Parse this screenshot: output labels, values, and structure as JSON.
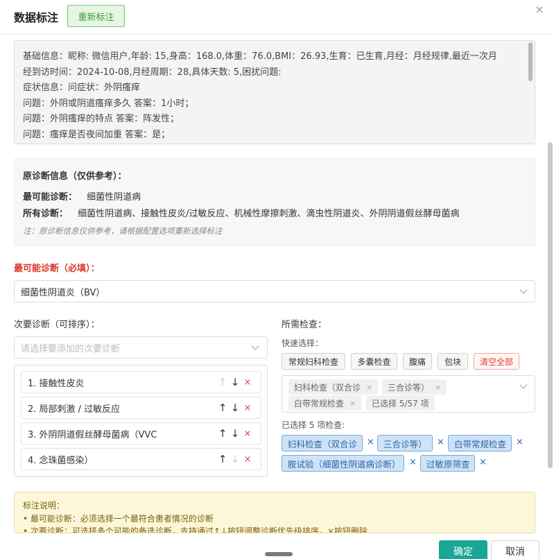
{
  "header": {
    "title": "数据标注",
    "reset_label": "重新标注",
    "close_glyph": "×"
  },
  "info": {
    "lines": [
      "基础信息：昵称: 微信用户,年龄: 15,身高：168.0,体重：76.0,BMI：26.93,生育：已生育,月经：月经规律,最近一次月",
      "经到访时间：2024-10-08,月经周期：28,具体天数: 5,困扰问题:",
      "症状信息：问症状：外阴瘙痒",
      "问题：外阴或阴道瘙痒多久 答案：1小时；",
      "问题：外阴瘙痒的特点 答案：阵发性；",
      "问题：瘙痒是否夜间加重 答案：是；"
    ]
  },
  "original": {
    "title": "原诊断信息（仅供参考）：",
    "most_likely_label": "最可能诊断：",
    "most_likely_value": "细菌性阴道病",
    "all_label": "所有诊断：",
    "all_value": "细菌性阴道病、接触性皮炎/过敏反应、机械性摩擦刺激、滴虫性阴道炎、外阴阴道假丝酵母菌病",
    "note": "注：原诊断信息仅供参考，请根据配置选项重新选择标注"
  },
  "main_diagnosis": {
    "label": "最可能诊断（必填）：",
    "value": "细菌性阴道炎（BV）"
  },
  "secondary": {
    "label": "次要诊断（可排序）：",
    "placeholder": "请选择要添加的次要诊断",
    "items": [
      {
        "label": "1. 接触性皮炎",
        "up": "↑",
        "down": "↓",
        "del": "×"
      },
      {
        "label": "2. 局部刺激 / 过敏反应",
        "up": "↑",
        "down": "↓",
        "del": "×"
      },
      {
        "label": "3. 外阴阴道假丝酵母菌病（VVC",
        "up": "↑",
        "down": "↓",
        "del": "×"
      },
      {
        "label": "4. 念珠菌感染）",
        "up": "↑",
        "down": "↓",
        "del": "×"
      }
    ]
  },
  "exams": {
    "label": "所需检查：",
    "quick_label": "快速选择：",
    "quick_buttons": [
      "常规妇科检查",
      "多囊检查",
      "腹痛",
      "包块",
      "清空全部"
    ],
    "tags": [
      "妇科检查（双合诊",
      "三合诊等）",
      "白带常规检查",
      "已选择 5/57 项"
    ],
    "tag_close": "×",
    "selected_label": "已选择 5 项检查:",
    "chips": [
      "妇科检查（双合诊",
      "三合诊等）",
      "白带常规检查",
      "胺试验（细菌性阴道病诊断）",
      "过敏原筛查"
    ],
    "chip_close": "×"
  },
  "tips": {
    "title": "标注说明：",
    "items": [
      "• 最可能诊断：必须选择一个最符合患者情况的诊断",
      "• 次要诊断：可选择多个可能的备选诊断，支持通过↑↓按钮调整诊断优先级排序，×按钮删除"
    ]
  },
  "footer": {
    "ok_label": "确定",
    "cancel_label": "取消"
  }
}
